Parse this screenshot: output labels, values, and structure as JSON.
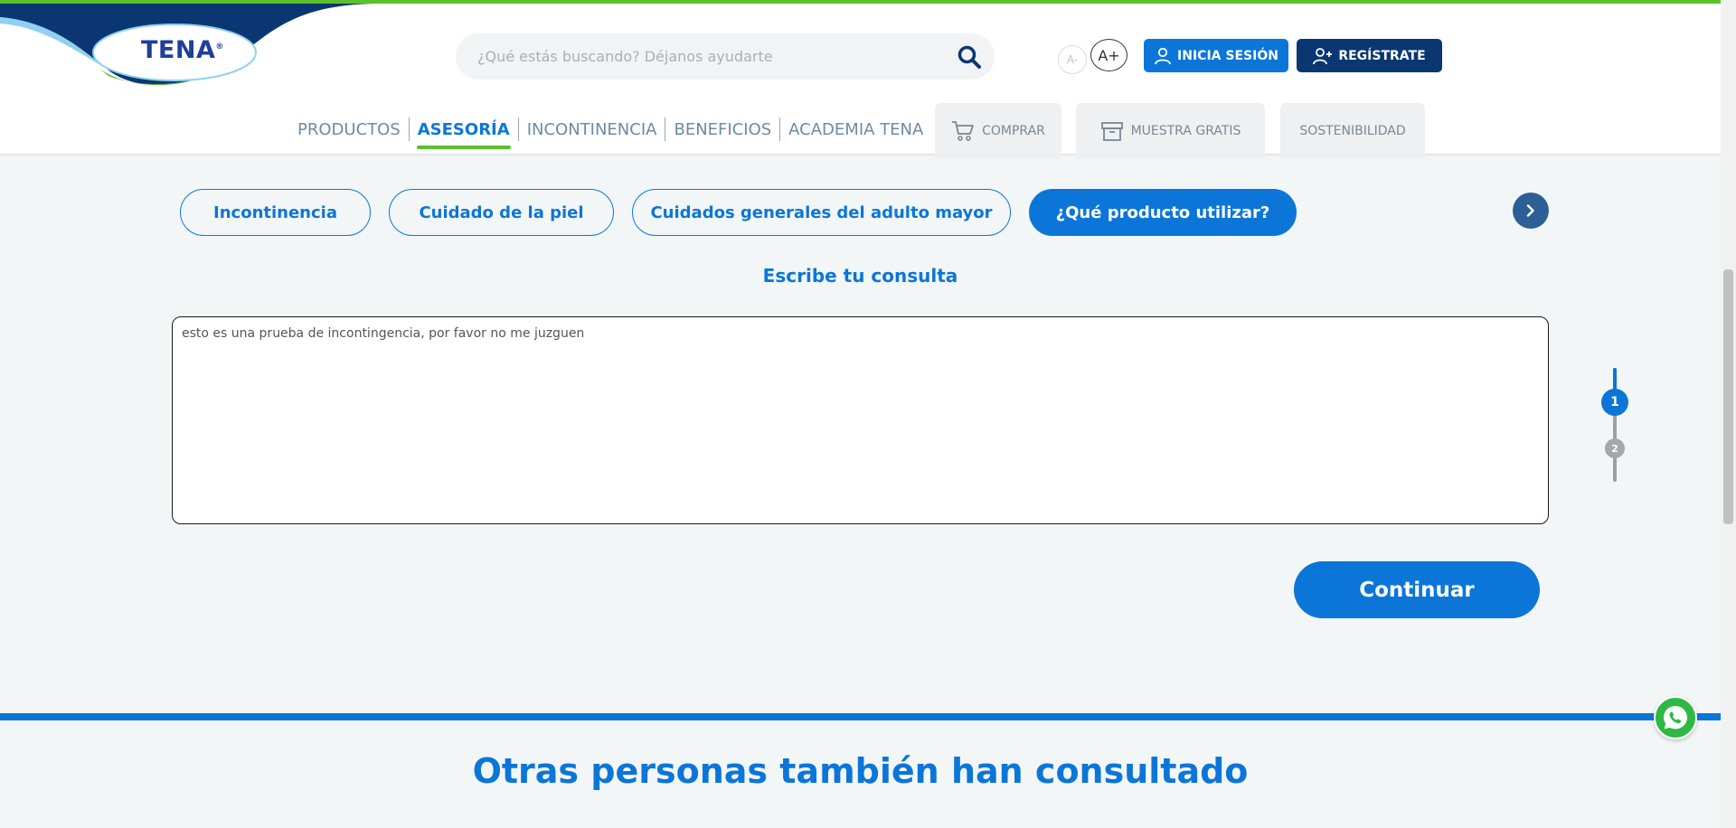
{
  "header": {
    "logo_text": "TENA",
    "search": {
      "placeholder": "¿Qué estás buscando? Déjanos ayudarte",
      "value": ""
    },
    "font_decrease_label": "A-",
    "font_increase_label": "A+",
    "login_label": "INICIA SESIÓN",
    "register_label": "REGÍSTRATE",
    "nav": [
      {
        "label": "PRODUCTOS"
      },
      {
        "label": "ASESORÍA",
        "active": true
      },
      {
        "label": "INCONTINENCIA"
      },
      {
        "label": "BENEFICIOS"
      },
      {
        "label": "ACADEMIA TENA"
      }
    ],
    "tabs": {
      "shop": "COMPRAR",
      "sample": "MUESTRA GRATIS",
      "sustainability": "SOSTENIBILIDAD"
    }
  },
  "categories": [
    {
      "label": "Incontinencia"
    },
    {
      "label": "Cuidado de la piel"
    },
    {
      "label": "Cuidados generales del adulto mayor"
    },
    {
      "label": "¿Qué producto utilizar?",
      "selected": true
    }
  ],
  "query": {
    "title": "Escribe tu consulta",
    "value": "esto es una prueba de incontingencia, por favor no me juzguen"
  },
  "stepper": {
    "steps": [
      "1",
      "2"
    ],
    "current": 1
  },
  "continue_label": "Continuar",
  "section_heading": "Otras personas también han consultado",
  "colors": {
    "primary": "#0b76d8",
    "navy": "#0a3772",
    "green": "#5ac12d",
    "whatsapp": "#2fb843"
  }
}
